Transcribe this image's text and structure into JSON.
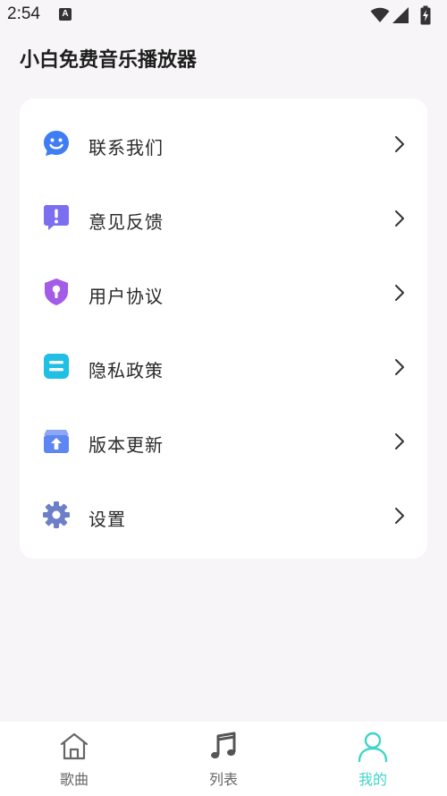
{
  "status_bar": {
    "time": "2:54",
    "notification_icon": "a-icon"
  },
  "page": {
    "title": "小白免费音乐播放器"
  },
  "menu": {
    "items": [
      {
        "label": "联系我们",
        "icon": "smile-chat-icon",
        "color": "#3f7ef2"
      },
      {
        "label": "意见反馈",
        "icon": "feedback-alert-icon",
        "color": "#7b6ff0"
      },
      {
        "label": "用户协议",
        "icon": "shield-lock-icon",
        "color": "#a45be8"
      },
      {
        "label": "隐私政策",
        "icon": "document-icon",
        "color": "#1fbfe6"
      },
      {
        "label": "版本更新",
        "icon": "update-box-icon",
        "color": "#5e86f2"
      },
      {
        "label": "设置",
        "icon": "gear-icon",
        "color": "#6d7fc8"
      }
    ]
  },
  "nav": {
    "items": [
      {
        "label": "歌曲",
        "icon": "home-icon",
        "active": false
      },
      {
        "label": "列表",
        "icon": "music-note-icon",
        "active": false
      },
      {
        "label": "我的",
        "icon": "user-icon",
        "active": true
      }
    ],
    "active_color": "#3fd5c8",
    "inactive_color": "#666666"
  }
}
